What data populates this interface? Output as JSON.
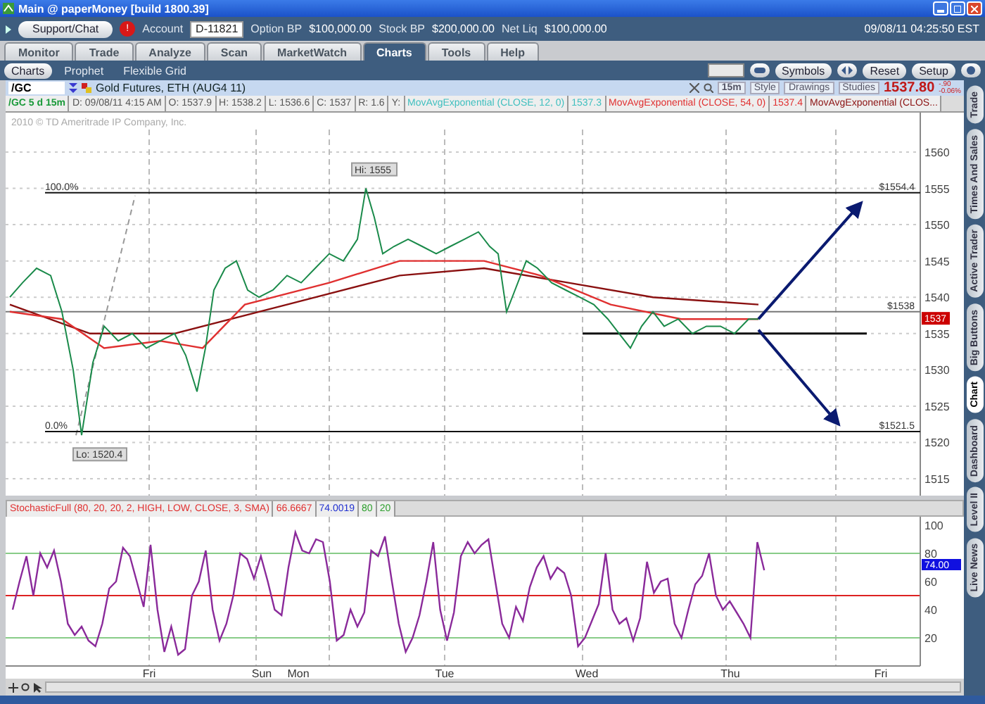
{
  "window": {
    "title": "Main @ paperMoney [build 1800.39]"
  },
  "account_bar": {
    "support_button": "Support/Chat",
    "alert_badge": "!",
    "account_label": "Account",
    "account_value": "D-11821",
    "fields": [
      {
        "label": "Option BP",
        "value": "$100,000.00"
      },
      {
        "label": "Stock BP",
        "value": "$200,000.00"
      },
      {
        "label": "Net Liq",
        "value": "$100,000.00"
      }
    ],
    "datetime": "09/08/11 04:25:50 EST"
  },
  "tabs": [
    {
      "label": "Monitor",
      "selected": false
    },
    {
      "label": "Trade",
      "selected": false
    },
    {
      "label": "Analyze",
      "selected": false
    },
    {
      "label": "Scan",
      "selected": false
    },
    {
      "label": "MarketWatch",
      "selected": false
    },
    {
      "label": "Charts",
      "selected": true
    },
    {
      "label": "Tools",
      "selected": false
    },
    {
      "label": "Help",
      "selected": false
    }
  ],
  "subtabs": [
    {
      "label": "Charts",
      "selected": true
    },
    {
      "label": "Prophet",
      "selected": false
    },
    {
      "label": "Flexible Grid",
      "selected": false
    }
  ],
  "chart_toolbar": {
    "buttons": [
      "Symbols",
      "Reset",
      "Setup"
    ]
  },
  "symbol_bar": {
    "symbol": "/GC",
    "description": "Gold Futures, ETH (AUG4 11)",
    "timeframe": "15m",
    "tools": [
      "Style",
      "Drawings",
      "Studies"
    ],
    "last_price": "1537.80",
    "change": "-.90",
    "change_pct": "-0.06%"
  },
  "info_strip": [
    {
      "text": "/GC 5 d 15m",
      "color": "#1a9a3a"
    },
    {
      "text": "D: 09/08/11 4:15 AM",
      "color": "#555555"
    },
    {
      "text": "O: 1537.9",
      "color": "#555555"
    },
    {
      "text": "H: 1538.2",
      "color": "#555555"
    },
    {
      "text": "L: 1536.6",
      "color": "#555555"
    },
    {
      "text": "C: 1537",
      "color": "#555555"
    },
    {
      "text": "R: 1.6",
      "color": "#555555"
    },
    {
      "text": "Y:",
      "color": "#555555"
    },
    {
      "text": "MovAvgExponential (CLOSE, 12, 0)",
      "color": "#3fbfbf"
    },
    {
      "text": "1537.3",
      "color": "#3fbfbf"
    },
    {
      "text": "MovAvgExponential (CLOSE, 54, 0)",
      "color": "#e03030"
    },
    {
      "text": "1537.4",
      "color": "#e03030"
    },
    {
      "text": "MovAvgExponential (CLOS...",
      "color": "#8a1010"
    }
  ],
  "price_chart": {
    "copyright": "2010 © TD Ameritrade IP Company, Inc.",
    "y_ticks": [
      "1560",
      "1555",
      "1550",
      "1545",
      "1540",
      "1535",
      "1530",
      "1525",
      "1520",
      "1515"
    ],
    "levels": [
      {
        "label": "100.0%",
        "price_label": "$1554.4"
      },
      {
        "price_label": "$1538"
      },
      {
        "label": "0.0%",
        "price_label": "$1521.5"
      }
    ],
    "high_label": "Hi: 1555",
    "low_label": "Lo: 1520.4",
    "current_price_tag": "1537"
  },
  "stochastic": {
    "header": [
      {
        "text": "StochasticFull (80, 20, 20, 2, HIGH, LOW, CLOSE, 3, SMA)",
        "color": "#e03030"
      },
      {
        "text": "66.6667",
        "color": "#e03030"
      },
      {
        "text": "74.0019",
        "color": "#2030d0"
      },
      {
        "text": "80",
        "color": "#30a030"
      },
      {
        "text": "20",
        "color": "#30a030"
      }
    ],
    "y_ticks": [
      "100",
      "80",
      "60",
      "40",
      "20"
    ],
    "current_tag": "74.00"
  },
  "x_axis": [
    "Fri",
    "Sun",
    "Mon",
    "Tue",
    "Wed",
    "Thu",
    "Fri"
  ],
  "side_tabs": [
    {
      "label": "Trade",
      "selected": false
    },
    {
      "label": "Times And Sales",
      "selected": false
    },
    {
      "label": "Active Trader",
      "selected": false
    },
    {
      "label": "Big Buttons",
      "selected": false
    },
    {
      "label": "Chart",
      "selected": true
    },
    {
      "label": "Dashboard",
      "selected": false
    },
    {
      "label": "Level II",
      "selected": false
    },
    {
      "label": "Live News",
      "selected": false
    }
  ]
}
